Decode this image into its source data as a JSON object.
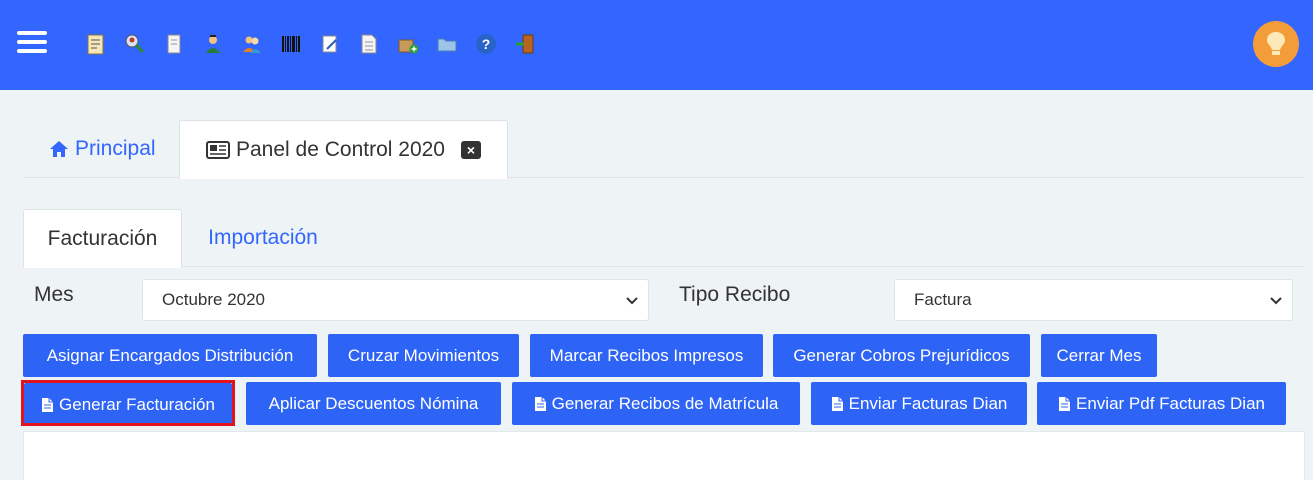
{
  "topbar": {
    "toolbar_icons": [
      "notepad-icon",
      "search-users-icon",
      "receipt-icon",
      "agent-icon",
      "users-icon",
      "barcode-icon",
      "edit-note-icon",
      "document-icon",
      "package-add-icon",
      "folder-icon",
      "help-icon",
      "exit-door-icon"
    ],
    "avatar_icon": "lightbulb-icon"
  },
  "main_tabs": [
    {
      "label": "Principal",
      "icon": "home-icon"
    },
    {
      "label": "Panel de Control 2020",
      "icon": "newspaper-icon",
      "close_icon": "close-icon"
    }
  ],
  "sub_tabs": [
    {
      "label": "Facturación"
    },
    {
      "label": "Importación"
    }
  ],
  "filters": {
    "mes_label": "Mes",
    "mes_value": "Octubre 2020",
    "tipo_label": "Tipo Recibo",
    "tipo_value": "Factura"
  },
  "actions_row1": [
    "Asignar Encargados Distribución",
    "Cruzar Movimientos",
    "Marcar Recibos Impresos",
    "Generar Cobros Prejurídicos",
    "Cerrar Mes"
  ],
  "actions_row2": [
    "Generar Facturación",
    "Aplicar Descuentos Nómina",
    "Generar Recibos de Matrícula",
    "Enviar Facturas Dian",
    "Enviar Pdf Facturas Dian"
  ],
  "colors": {
    "topbar": "#3366ff",
    "button": "#2e64f5",
    "highlight": "#e0131d",
    "link": "#3366ff",
    "avatar": "#f39c3a"
  }
}
